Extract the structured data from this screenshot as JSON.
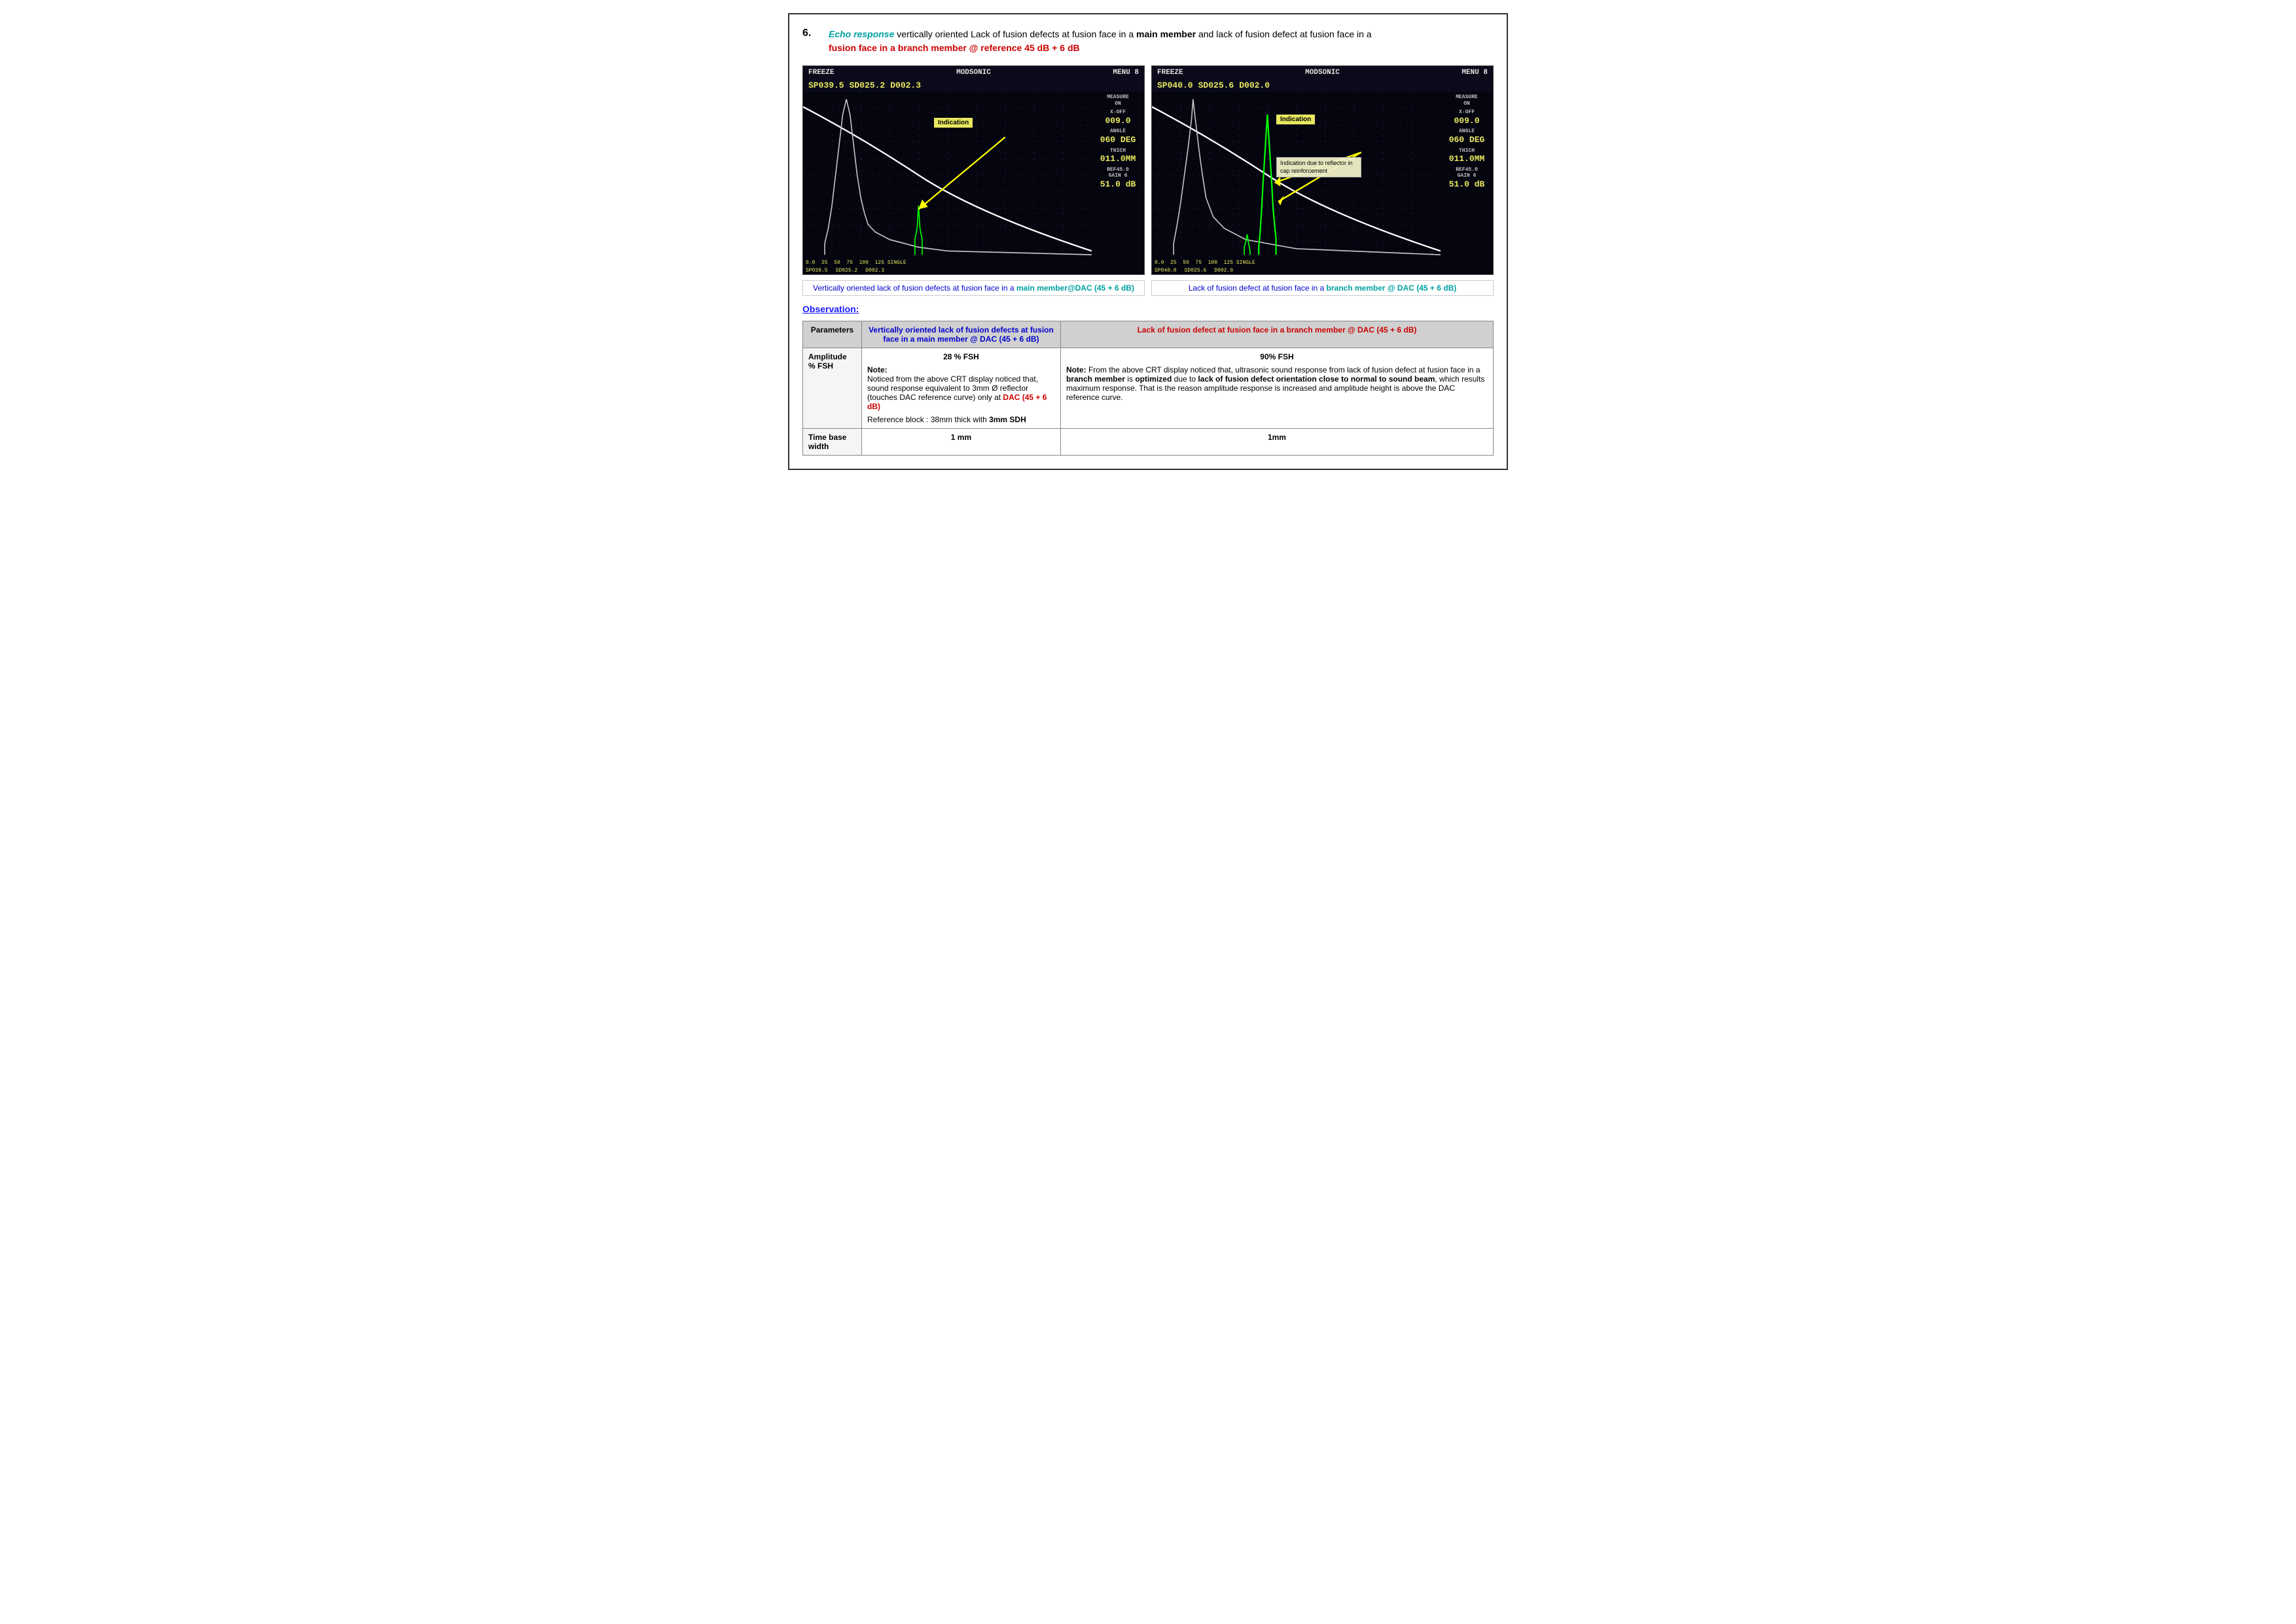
{
  "page": {
    "section_number": "6.",
    "title_parts": {
      "echo_response": "Echo response",
      "rest": " vertically oriented Lack of fusion defects at fusion face in a ",
      "main_member": "main member",
      "and": " and",
      "lack": " lack of fusion defect at fusion face in a ",
      "branch_member": "branch member",
      "at_ref": " @ reference 45 dB + 6 dB"
    }
  },
  "image_left": {
    "header": {
      "freeze": "FREEZE",
      "modsonic": "MODSONIC",
      "menu": "MENU 8"
    },
    "values": {
      "sp": "SP039.5",
      "sd": "SD025.2",
      "d": "D002.3"
    },
    "sidebar": {
      "measure": "MEASURE",
      "on": "ON",
      "x_off": "X-OFF",
      "x_val": "009.0",
      "angle": "ANGLE",
      "angle_val": "060 DEG",
      "thich": "THICH",
      "thich_val": "011.0MM",
      "ref": "REF45.0",
      "gain": "GAIN 6",
      "db_val": "51.0 dB"
    },
    "bottom": {
      "axis": "0.0   25   50   75   100   125 SINGLE",
      "sp": "SP039.5",
      "sd": "SD025.2",
      "d": "D002.3"
    },
    "indication_label": "Indication"
  },
  "image_right": {
    "header": {
      "freeze": "FREEZE",
      "modsonic": "MODSONIC",
      "menu": "MENU 8"
    },
    "values": {
      "sp": "SP040.0",
      "sd": "SD025.6",
      "d": "D002.0"
    },
    "sidebar": {
      "measure": "MEASURE",
      "on": "ON",
      "x_off": "X-OFF",
      "x_val": "009.0",
      "angle": "ANGLE",
      "angle_val": "060 DEG",
      "thich": "THICH",
      "thich_val": "011.0MM",
      "ref": "REF45.0",
      "gain": "GAIN 6",
      "db_val": "51.0 dB"
    },
    "bottom": {
      "axis": "0.0   25   50   75   100   125 SINGLE",
      "sp": "SP040.0",
      "sd": "SD025.6",
      "d": "D002.0"
    },
    "indication_label": "Indication",
    "indication_note": "Indication due to reflector in cap reinforcement"
  },
  "captions": {
    "left": "Vertically oriented lack of fusion defects at fusion face in a ",
    "left_bold": "main member",
    "left_dac": "@DAC (45 + 6 dB)",
    "right": "Lack of fusion defect at fusion face in a ",
    "right_bold": "branch member",
    "right_dac": "@ DAC (45 + 6 dB)"
  },
  "observation": {
    "title": "Observation:",
    "table": {
      "col_param": "Parameters",
      "col_left": "Vertically oriented lack of fusion defects at fusion face in a main member @ DAC (45 + 6 dB)",
      "col_right": "Lack of fusion defect at fusion face in a branch member @ DAC (45 + 6 dB)",
      "rows": [
        {
          "param": "Amplitude % FSH",
          "left_heading": "28 % FSH",
          "left_note_label": "Note:",
          "left_note": "Noticed from the above CRT display noticed that, sound response equivalent to 3mm Ø reflector (touches DAC reference curve) only at",
          "left_dac": "DAC (45 + 6 dB)",
          "left_ref": "Reference block : 38mm thick with 3mm SDH",
          "right_heading": "90% FSH",
          "right_note_label": "Note:",
          "right_note1": "From the above CRT display noticed that, ultrasonic sound response from lack of fusion defect at fusion face in a ",
          "right_bold1": "branch member",
          "right_note2": " is ",
          "right_bold2": "optimized",
          "right_note3": " due to ",
          "right_bold3": "lack of fusion defect orientation close to normal to sound beam",
          "right_note4": ", which results maximum response. That is the reason amplitude response is increased and amplitude height is above the DAC reference curve."
        },
        {
          "param": "Time base width",
          "left_val": "1 mm",
          "right_val": "1mm"
        }
      ]
    }
  }
}
